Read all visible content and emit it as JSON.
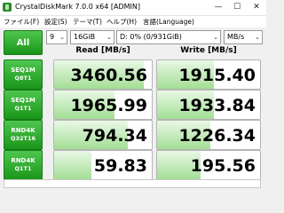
{
  "window": {
    "title": "CrystalDiskMark 7.0.0 x64 [ADMIN]",
    "minimize": "—",
    "maximize": "☐",
    "close": "✕"
  },
  "menu": [
    "ファイル(F)",
    "設定(S)",
    "テーマ(T)",
    "ヘルプ(H)",
    "言語(Language)"
  ],
  "controls": {
    "all_label": "All",
    "count": "9",
    "size": "16GiB",
    "drive": "D: 0% (0/931GiB)",
    "unit": "MB/s"
  },
  "headers": {
    "read": "Read [MB/s]",
    "write": "Write [MB/s]"
  },
  "rows": [
    {
      "line1": "SEQ1M",
      "line2": "Q8T1",
      "read": "3460.56",
      "write": "1915.40",
      "read_fill": 0.92,
      "write_fill": 0.55
    },
    {
      "line1": "SEQ1M",
      "line2": "Q1T1",
      "read": "1965.99",
      "write": "1933.84",
      "read_fill": 0.62,
      "write_fill": 0.55
    },
    {
      "line1": "RND4K",
      "line2": "Q32T16",
      "read": "794.34",
      "write": "1226.34",
      "read_fill": 0.75,
      "write_fill": 0.52
    },
    {
      "line1": "RND4K",
      "line2": "Q1T1",
      "read": "59.83",
      "write": "195.56",
      "read_fill": 0.38,
      "write_fill": 0.42
    }
  ],
  "colors": {
    "accent": "#1a961a",
    "bar_light": "#e9f8e6",
    "bar_dark": "#a3de95"
  }
}
